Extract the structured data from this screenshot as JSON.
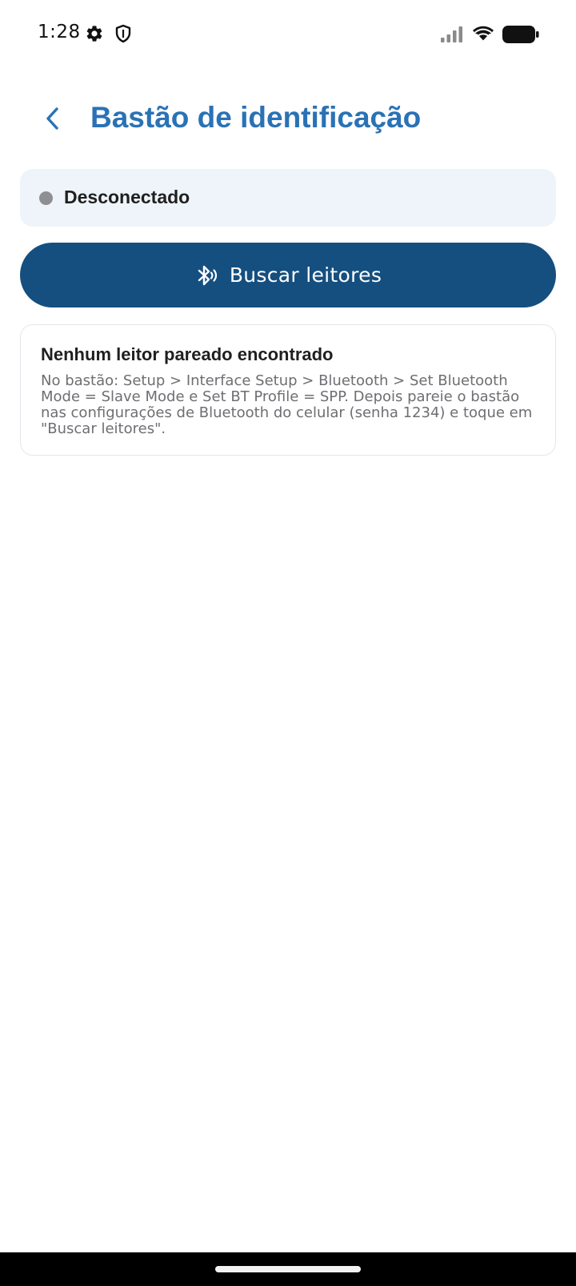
{
  "status_bar": {
    "time": "1:28",
    "icons": [
      "gear-icon",
      "shield-icon",
      "signal-icon",
      "wifi-icon",
      "battery-icon"
    ]
  },
  "header": {
    "back_icon": "chevron-left-icon",
    "title": "Bastão de identificação",
    "title_color": "#2a72b5"
  },
  "connection": {
    "status_label": "Desconectado",
    "dot_color": "#8e8e93",
    "background": "#eff4fa"
  },
  "scan_button": {
    "icon": "bluetooth-searching-icon",
    "label": "Buscar leitores",
    "background": "#154f80"
  },
  "info_card": {
    "title": "Nenhum leitor pareado encontrado",
    "body": "No bastão: Setup > Interface Setup > Bluetooth > Set Bluetooth Mode = Slave Mode e Set BT Profile = SPP. Depois pareie o bastão nas configurações de Bluetooth do celular (senha 1234) e toque em \"Buscar leitores\"."
  }
}
